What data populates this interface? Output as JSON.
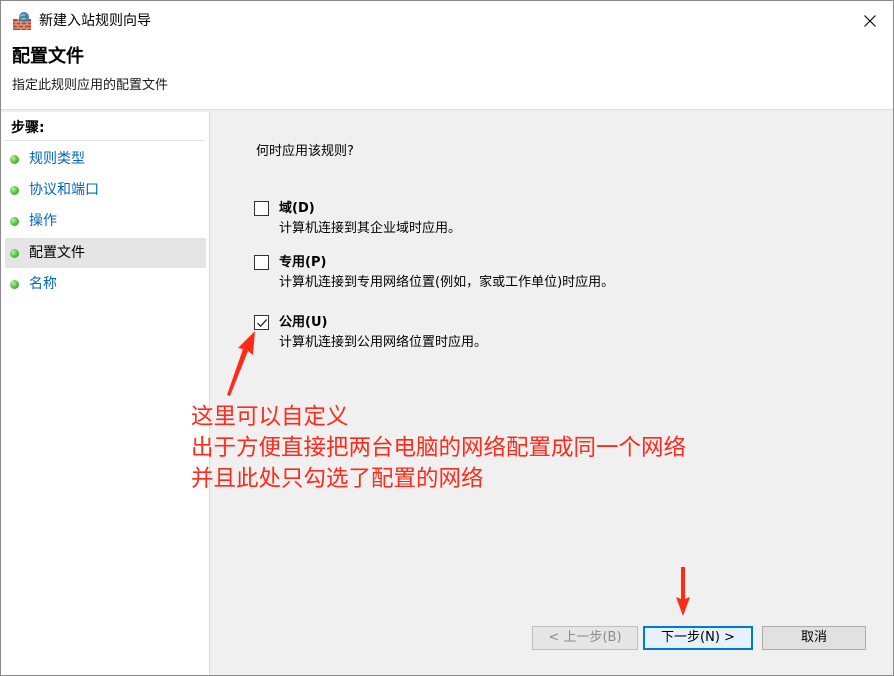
{
  "window": {
    "title": "新建入站规则向导"
  },
  "header": {
    "title": "配置文件",
    "subtitle": "指定此规则应用的配置文件"
  },
  "sidebar": {
    "heading": "步骤:",
    "items": [
      {
        "label": "规则类型"
      },
      {
        "label": "协议和端口"
      },
      {
        "label": "操作"
      },
      {
        "label": "配置文件",
        "current": true
      },
      {
        "label": "名称"
      }
    ]
  },
  "main": {
    "question": "何时应用该规则?",
    "options": [
      {
        "title": "域(D)",
        "description": "计算机连接到其企业域时应用。",
        "checked": false
      },
      {
        "title": "专用(P)",
        "description": "计算机连接到专用网络位置(例如，家或工作单位)时应用。",
        "checked": false
      },
      {
        "title": "公用(U)",
        "description": "计算机连接到公用网络位置时应用。",
        "checked": true
      }
    ]
  },
  "annotation": {
    "lines": [
      "这里可以自定义",
      "出于方便直接把两台电脑的网络配置成同一个网络",
      "并且此处只勾选了配置的网络"
    ],
    "color": "#ff2a1a"
  },
  "buttons": {
    "back": "< 上一步(B)",
    "next": "下一步(N) >",
    "cancel": "取消"
  }
}
